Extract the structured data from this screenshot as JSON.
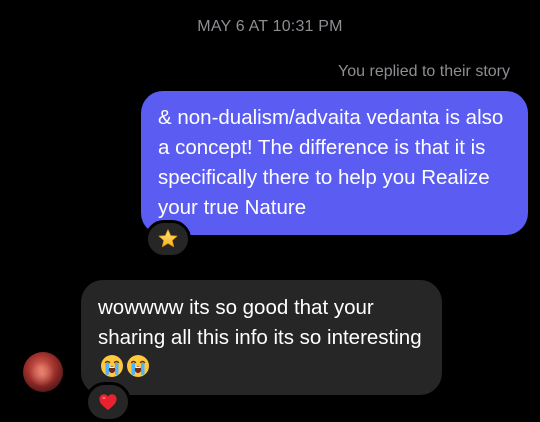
{
  "thread": {
    "timestamp": "MAY 6 AT 10:31 PM",
    "reply_note": "You replied to their story"
  },
  "messages": [
    {
      "direction": "outgoing",
      "text": "& non-dualism/advaita vedanta is also a concept! The difference is that it is specifically there to help you Realize your true Nature",
      "reaction": "star-emoji"
    },
    {
      "direction": "incoming",
      "text": "wowwww its so good that your sharing all this info its so interesting",
      "emojis": [
        "loudly-crying-face",
        "loudly-crying-face"
      ],
      "reaction": "red-heart"
    }
  ],
  "colors": {
    "background": "#000000",
    "outgoing_bubble": "#5a5cf2",
    "incoming_bubble": "#262626",
    "meta_text": "#8e8e93"
  }
}
